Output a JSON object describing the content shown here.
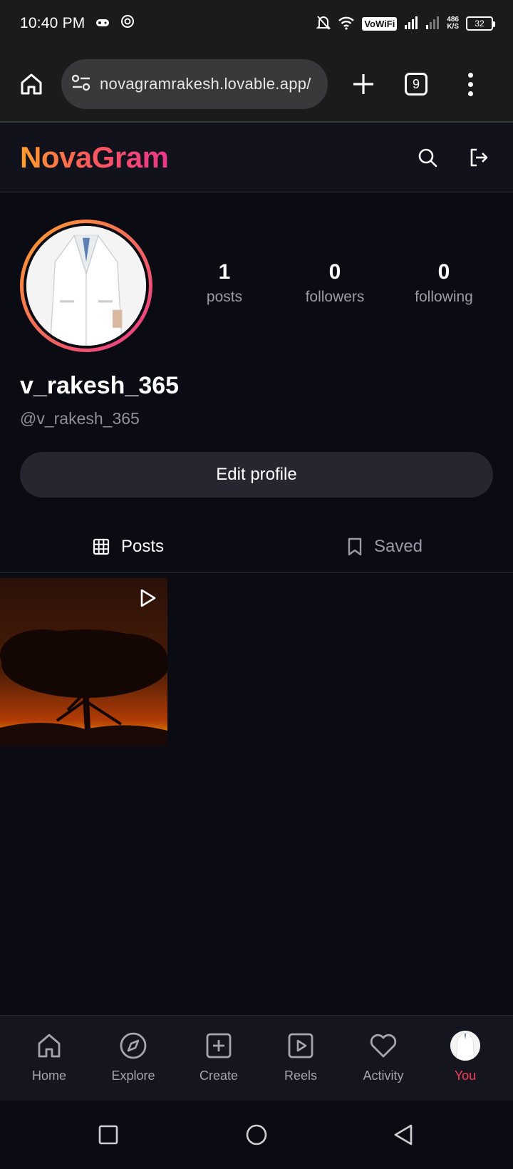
{
  "status_bar": {
    "time": "10:40 PM",
    "vowifi": "VoWiFi",
    "speed_value": "486",
    "speed_unit": "K/S",
    "battery": "32"
  },
  "browser": {
    "url": "novagramrakesh.lovable.app/",
    "tab_count": "9"
  },
  "app": {
    "brand": "NovaGram"
  },
  "profile": {
    "stats": [
      {
        "value": "1",
        "label": "posts"
      },
      {
        "value": "0",
        "label": "followers"
      },
      {
        "value": "0",
        "label": "following"
      }
    ],
    "display_name": "v_rakesh_365",
    "handle": "@v_rakesh_365",
    "edit_label": "Edit profile"
  },
  "tabs": [
    {
      "label": "Posts",
      "active": true
    },
    {
      "label": "Saved",
      "active": false
    }
  ],
  "bottom_nav": [
    {
      "label": "Home",
      "icon": "home-icon"
    },
    {
      "label": "Explore",
      "icon": "compass-icon"
    },
    {
      "label": "Create",
      "icon": "plus-square-icon"
    },
    {
      "label": "Reels",
      "icon": "reels-icon"
    },
    {
      "label": "Activity",
      "icon": "heart-icon"
    },
    {
      "label": "You",
      "icon": "avatar",
      "active": true
    }
  ],
  "colors": {
    "accent_active": "#ff3b5c",
    "brand_gradient_start": "#ff9f2a",
    "brand_gradient_end": "#e8378c"
  }
}
